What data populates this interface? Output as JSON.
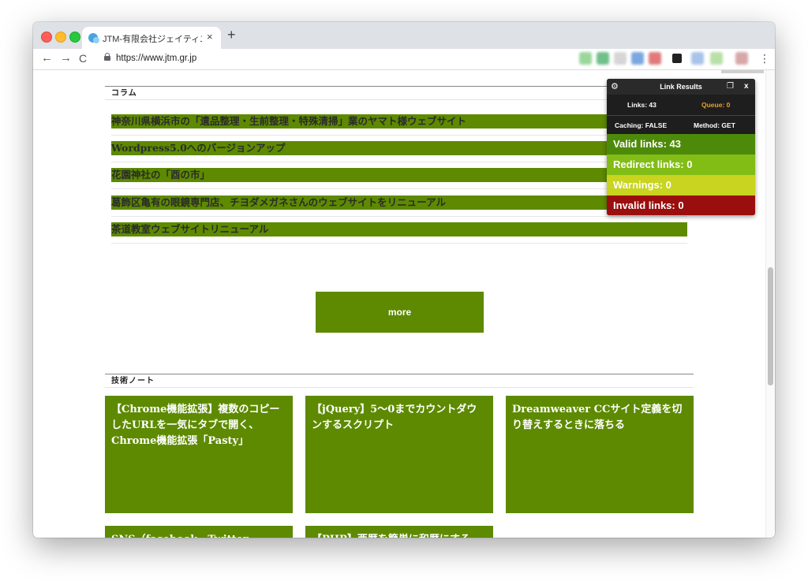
{
  "browser": {
    "tab_title": "JTM-有限会社ジェイティエム［W",
    "tab_close": "×",
    "new_tab": "+",
    "url": "https://www.jtm.gr.jp",
    "nav": {
      "back": "←",
      "forward": "→",
      "reload": "C"
    },
    "star": "☆",
    "menu": "⋮"
  },
  "column_section": {
    "heading": "コラム",
    "items": [
      "神奈川県横浜市の「遺品整理・生前整理・特殊清掃」業のヤマト様ウェブサイト",
      "Wordpress5.0へのバージョンアップ",
      "花園神社の「酉の市」",
      "葛飾区亀有の眼鏡専門店、チヨダメガネさんのウェブサイトをリニューアル",
      "茶道教室ウェブサイトリニューアル"
    ]
  },
  "more_button": "more",
  "tech_section": {
    "heading": "技術ノート",
    "cards": [
      "【Chrome機能拡張】複数のコピーしたURLを一気にタブで開く、Chrome機能拡張「Pasty」",
      "【jQuery】5〜0までカウントダウンするスクリプト",
      "Dreamweaver CCサイト定義を切り替えするときに落ちる",
      "SNS（facebook、Twitter",
      "【PHP】西暦を簡単に和暦にする"
    ]
  },
  "link_results": {
    "title": "Link Results",
    "links": "Links: 43",
    "queue": "Queue: 0",
    "caching": "Caching: FALSE",
    "method": "Method: GET",
    "valid": "Valid links: 43",
    "redirect": "Redirect links: 0",
    "warnings": "Warnings: 0",
    "invalid": "Invalid links: 0",
    "close": "x",
    "colors": {
      "valid": "#4e8a0a",
      "redirect": "#82bd16",
      "warnings": "#c8d41f",
      "invalid": "#9b0e0e",
      "queue": "#f0a020"
    }
  },
  "colors": {
    "accent_green": "#5d8a00"
  }
}
